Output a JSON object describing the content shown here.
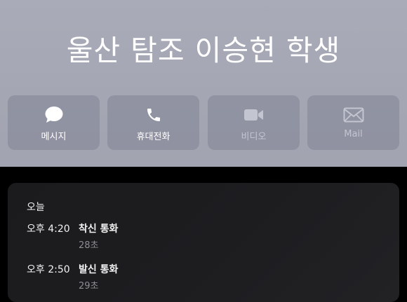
{
  "contact": {
    "name": "울산 탐조 이승현 학생"
  },
  "actions": [
    {
      "label": "메시지",
      "icon": "message-bubble-icon",
      "enabled": true
    },
    {
      "label": "휴대전화",
      "icon": "phone-icon",
      "enabled": true
    },
    {
      "label": "비디오",
      "icon": "video-camera-icon",
      "enabled": false
    },
    {
      "label": "Mail",
      "icon": "mail-envelope-icon",
      "enabled": false
    }
  ],
  "recents": {
    "day": "오늘",
    "calls": [
      {
        "time": "오후 4:20",
        "type": "착신 통화",
        "duration": "28초"
      },
      {
        "time": "오후 2:50",
        "type": "발신 통화",
        "duration": "29초"
      }
    ]
  },
  "colors": {
    "header_bg": "#a6a8b5",
    "button_bg": "#8d8fa0",
    "card_bg": "#1c1c1e",
    "secondary_text": "#8e8e93"
  }
}
